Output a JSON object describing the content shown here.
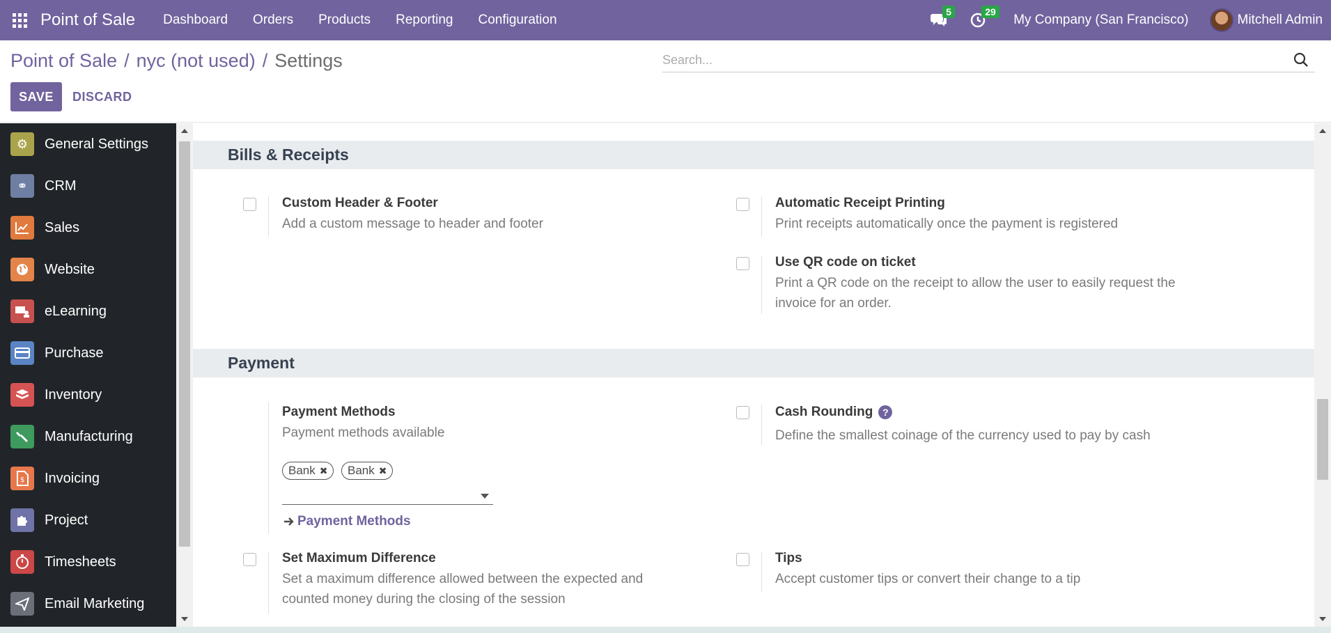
{
  "navbar": {
    "brand": "Point of Sale",
    "menu": [
      "Dashboard",
      "Orders",
      "Products",
      "Reporting",
      "Configuration"
    ],
    "messages_count": "5",
    "activities_count": "29",
    "company": "My Company (San Francisco)",
    "user": "Mitchell Admin",
    "accent": "#71639e"
  },
  "breadcrumb": {
    "root": "Point of Sale",
    "record": "nyc (not used)",
    "current": "Settings",
    "separator": "/"
  },
  "search": {
    "placeholder": "Search..."
  },
  "buttons": {
    "save": "SAVE",
    "discard": "DISCARD"
  },
  "sidebar": {
    "items": [
      {
        "label": "General Settings",
        "icon": "gear-icon",
        "color": "#a9a44b"
      },
      {
        "label": "CRM",
        "icon": "handshake-icon",
        "color": "#6f7fa3"
      },
      {
        "label": "Sales",
        "icon": "chart-line-icon",
        "color": "#e07a3f"
      },
      {
        "label": "Website",
        "icon": "globe-icon",
        "color": "#e4834a"
      },
      {
        "label": "eLearning",
        "icon": "elearning-icon",
        "color": "#c8504f"
      },
      {
        "label": "Purchase",
        "icon": "credit-card-icon",
        "color": "#5a84c3"
      },
      {
        "label": "Inventory",
        "icon": "box-icon",
        "color": "#d65353"
      },
      {
        "label": "Manufacturing",
        "icon": "wrench-icon",
        "color": "#3f9a5e"
      },
      {
        "label": "Invoicing",
        "icon": "invoice-icon",
        "color": "#e6784b"
      },
      {
        "label": "Project",
        "icon": "puzzle-icon",
        "color": "#6f73a8"
      },
      {
        "label": "Timesheets",
        "icon": "stopwatch-icon",
        "color": "#cc4747"
      },
      {
        "label": "Email Marketing",
        "icon": "paper-plane-icon",
        "color": "#6b7078"
      }
    ]
  },
  "sections": {
    "bills": {
      "title": "Bills & Receipts",
      "custom_header": {
        "title": "Custom Header & Footer",
        "desc": "Add a custom message to header and footer"
      },
      "auto_print": {
        "title": "Automatic Receipt Printing",
        "desc": "Print receipts automatically once the payment is registered"
      },
      "qr_code": {
        "title": "Use QR code on ticket",
        "desc": "Print a QR code on the receipt to allow the user to easily request the invoice for an order."
      }
    },
    "payment": {
      "title": "Payment",
      "methods": {
        "title": "Payment Methods",
        "desc": "Payment methods available",
        "tags": [
          "Bank",
          "Bank"
        ],
        "link": "Payment Methods"
      },
      "cash_rounding": {
        "title": "Cash Rounding",
        "desc": "Define the smallest coinage of the currency used to pay by cash"
      },
      "max_difference": {
        "title": "Set Maximum Difference",
        "desc": "Set a maximum difference allowed between the expected and counted money during the closing of the session"
      },
      "tips": {
        "title": "Tips",
        "desc": "Accept customer tips or convert their change to a tip"
      }
    }
  }
}
